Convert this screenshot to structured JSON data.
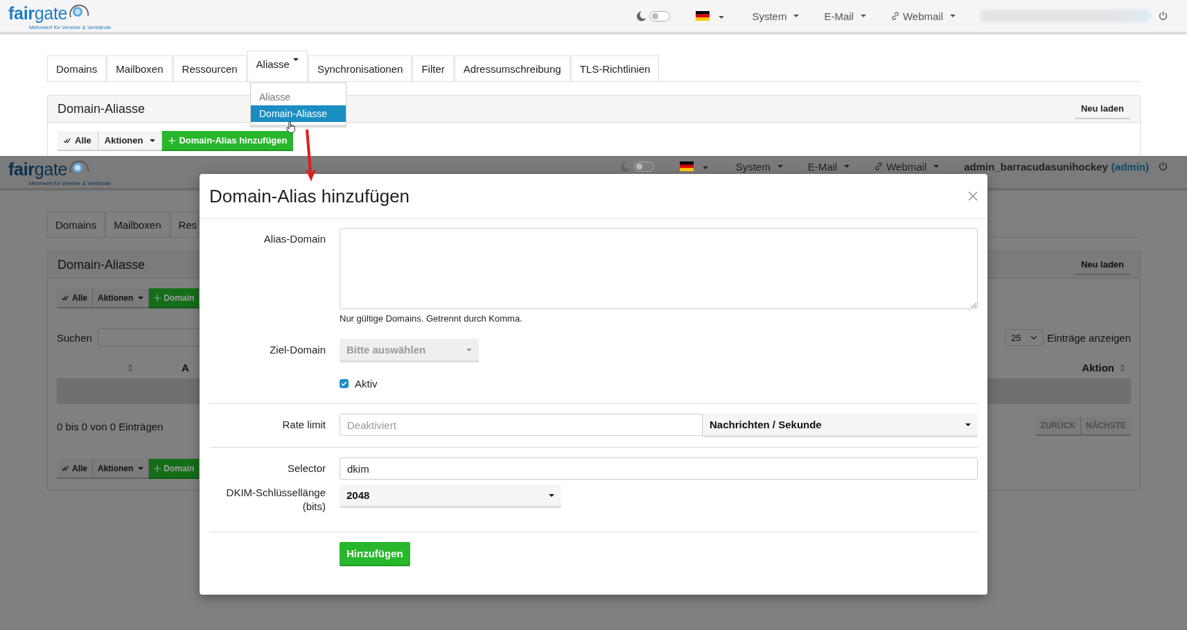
{
  "before": {
    "header": {
      "logo": "**fair**gate",
      "tagline": "Mehrwert für Vereine & Verbände",
      "dark_mode": false,
      "menus": [
        {
          "label": "System",
          "kind": "menu"
        },
        {
          "label": "E-Mail",
          "kind": "menu"
        },
        {
          "label": "Webmail",
          "kind": "link"
        }
      ],
      "user_hidden": true
    },
    "tabs": [
      {
        "label": "Domains",
        "kind": "tab",
        "selected": false
      },
      {
        "label": "Mailboxen",
        "kind": "tab",
        "selected": false
      },
      {
        "label": "Ressourcen",
        "kind": "tab",
        "selected": false
      },
      {
        "label": "Aliasse",
        "kind": "menu",
        "selected": true
      },
      {
        "label": "Synchronisationen",
        "kind": "tab",
        "selected": false
      },
      {
        "label": "Filter",
        "kind": "tab",
        "selected": false
      },
      {
        "label": "Adressumschreibung",
        "kind": "tab",
        "selected": false
      },
      {
        "label": "TLS-Richtlinien",
        "kind": "tab",
        "selected": false
      }
    ],
    "dropdown_menu": [
      {
        "label": "Aliasse",
        "kind": "header",
        "selected": false
      },
      {
        "label": "Domain-Aliasse",
        "kind": "item",
        "selected": true
      }
    ],
    "panel": {
      "title": "Domain-Aliasse",
      "reload": "Neu laden",
      "toolbar": [
        {
          "label": "Alle",
          "kind": "select-all"
        },
        {
          "label": "Aktionen",
          "kind": "dropdown"
        },
        {
          "label": "Domain-Alias hinzufügen",
          "kind": "add"
        }
      ]
    }
  },
  "after": {
    "header": {
      "logo": "**fair**gate",
      "tagline": "Mehrwert für Vereine & Verbände",
      "dark_mode": false,
      "menus": [
        {
          "label": "System",
          "kind": "menu"
        },
        {
          "label": "E-Mail",
          "kind": "menu"
        },
        {
          "label": "Webmail",
          "kind": "link"
        }
      ],
      "user": "admin_barracudasunihockey",
      "role": "(admin)"
    },
    "tabs": [
      {
        "label": "Domains",
        "kind": "tab",
        "selected": false
      },
      {
        "label": "Mailboxen",
        "kind": "tab",
        "selected": false
      },
      {
        "label": "Res",
        "kind": "tab",
        "selected": false
      }
    ],
    "panel": {
      "title": "Domain-Aliasse",
      "reload": "Neu laden",
      "toolbar": [
        {
          "label": "Alle",
          "kind": "select-all"
        },
        {
          "label": "Aktionen",
          "kind": "dropdown"
        },
        {
          "label": "Domain",
          "kind": "add"
        }
      ],
      "search_label": "Suchen",
      "page_size": "25",
      "page_size_label": "Einträge anzeigen",
      "columns": [
        "A",
        "Aktion"
      ],
      "info": "0 bis 0 von 0 Einträgen",
      "pager": [
        {
          "label": "ZURÜCK",
          "disabled": true
        },
        {
          "label": "NÄCHSTE",
          "disabled": true
        }
      ],
      "bottom_toolbar": [
        {
          "label": "Alle",
          "kind": "select-all"
        },
        {
          "label": "Aktionen",
          "kind": "dropdown"
        },
        {
          "label": "Domain",
          "kind": "add"
        }
      ]
    }
  },
  "modal": {
    "title": "Domain-Alias hinzufügen",
    "alias_domain": {
      "label": "Alias-Domain",
      "help": "Nur gültige Domains. Getrennt durch Komma."
    },
    "target_domain": {
      "label": "Ziel-Domain",
      "placeholder": "Bitte auswählen"
    },
    "active": {
      "label": "Aktiv",
      "checked": true
    },
    "rate_limit": {
      "label": "Rate limit",
      "placeholder": "Deaktiviert",
      "unit": "Nachrichten / Sekunde"
    },
    "selector": {
      "label": "Selector",
      "value": "dkim"
    },
    "dkim_length": {
      "label": "DKIM-Schlüssellänge (bits)",
      "value": "2048"
    },
    "submit": "Hinzufügen"
  }
}
